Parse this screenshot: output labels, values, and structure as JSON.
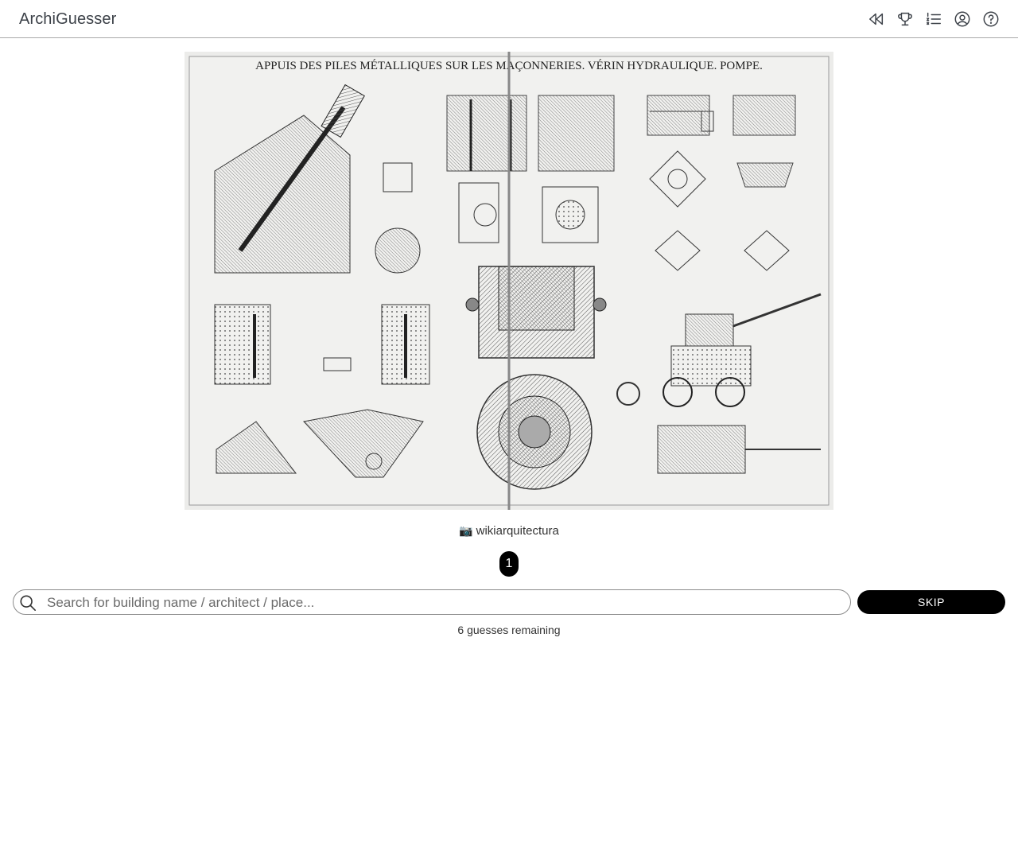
{
  "app": {
    "title": "ArchiGuesser"
  },
  "header": {
    "icons": [
      "rewind-icon",
      "trophy-icon",
      "ranked-list-icon",
      "account-icon",
      "help-icon"
    ]
  },
  "photo": {
    "plate_title": "APPUIS DES PILES MÉTALLIQUES SUR LES MAÇONNERIES. VÉRIN HYDRAULIQUE. POMPE.",
    "credit": "wikiarquitectura"
  },
  "round": {
    "number": "1"
  },
  "search": {
    "placeholder": "Search for building name / architect / place..."
  },
  "skip": {
    "label": "SKIP"
  },
  "status": {
    "guesses_remaining": "6 guesses remaining"
  },
  "colors": {
    "accent": "#000000",
    "text": "#3c4148",
    "border": "#a9a9a9"
  }
}
